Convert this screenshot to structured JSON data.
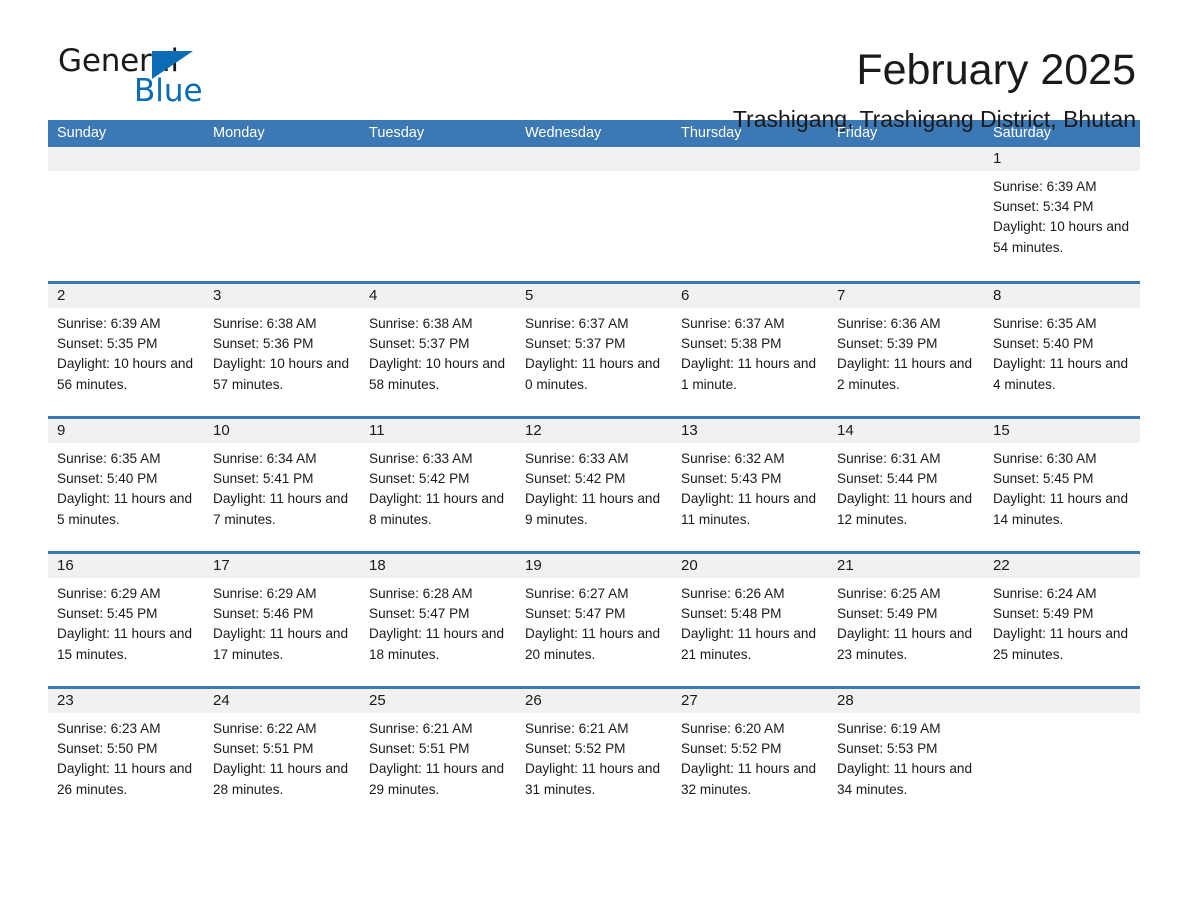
{
  "brand": {
    "name_part1": "General",
    "name_part2": "Blue",
    "triangle_color": "#0a6cb5",
    "text_color": "#1a1a1a"
  },
  "header": {
    "title": "February 2025",
    "subtitle": "Trashigang, Trashigang District, Bhutan"
  },
  "theme": {
    "header_blue": "#3b78b4",
    "date_band_gray": "#f1f1f1",
    "cell_white": "#ffffff"
  },
  "weekdays": [
    "Sunday",
    "Monday",
    "Tuesday",
    "Wednesday",
    "Thursday",
    "Friday",
    "Saturday"
  ],
  "calendar": {
    "month": "February",
    "year": "2025",
    "weeks": [
      [
        {
          "day": ""
        },
        {
          "day": ""
        },
        {
          "day": ""
        },
        {
          "day": ""
        },
        {
          "day": ""
        },
        {
          "day": ""
        },
        {
          "day": "1",
          "sunrise": "Sunrise: 6:39 AM",
          "sunset": "Sunset: 5:34 PM",
          "daylight": "Daylight: 10 hours and 54 minutes."
        }
      ],
      [
        {
          "day": "2",
          "sunrise": "Sunrise: 6:39 AM",
          "sunset": "Sunset: 5:35 PM",
          "daylight": "Daylight: 10 hours and 56 minutes."
        },
        {
          "day": "3",
          "sunrise": "Sunrise: 6:38 AM",
          "sunset": "Sunset: 5:36 PM",
          "daylight": "Daylight: 10 hours and 57 minutes."
        },
        {
          "day": "4",
          "sunrise": "Sunrise: 6:38 AM",
          "sunset": "Sunset: 5:37 PM",
          "daylight": "Daylight: 10 hours and 58 minutes."
        },
        {
          "day": "5",
          "sunrise": "Sunrise: 6:37 AM",
          "sunset": "Sunset: 5:37 PM",
          "daylight": "Daylight: 11 hours and 0 minutes."
        },
        {
          "day": "6",
          "sunrise": "Sunrise: 6:37 AM",
          "sunset": "Sunset: 5:38 PM",
          "daylight": "Daylight: 11 hours and 1 minute."
        },
        {
          "day": "7",
          "sunrise": "Sunrise: 6:36 AM",
          "sunset": "Sunset: 5:39 PM",
          "daylight": "Daylight: 11 hours and 2 minutes."
        },
        {
          "day": "8",
          "sunrise": "Sunrise: 6:35 AM",
          "sunset": "Sunset: 5:40 PM",
          "daylight": "Daylight: 11 hours and 4 minutes."
        }
      ],
      [
        {
          "day": "9",
          "sunrise": "Sunrise: 6:35 AM",
          "sunset": "Sunset: 5:40 PM",
          "daylight": "Daylight: 11 hours and 5 minutes."
        },
        {
          "day": "10",
          "sunrise": "Sunrise: 6:34 AM",
          "sunset": "Sunset: 5:41 PM",
          "daylight": "Daylight: 11 hours and 7 minutes."
        },
        {
          "day": "11",
          "sunrise": "Sunrise: 6:33 AM",
          "sunset": "Sunset: 5:42 PM",
          "daylight": "Daylight: 11 hours and 8 minutes."
        },
        {
          "day": "12",
          "sunrise": "Sunrise: 6:33 AM",
          "sunset": "Sunset: 5:42 PM",
          "daylight": "Daylight: 11 hours and 9 minutes."
        },
        {
          "day": "13",
          "sunrise": "Sunrise: 6:32 AM",
          "sunset": "Sunset: 5:43 PM",
          "daylight": "Daylight: 11 hours and 11 minutes."
        },
        {
          "day": "14",
          "sunrise": "Sunrise: 6:31 AM",
          "sunset": "Sunset: 5:44 PM",
          "daylight": "Daylight: 11 hours and 12 minutes."
        },
        {
          "day": "15",
          "sunrise": "Sunrise: 6:30 AM",
          "sunset": "Sunset: 5:45 PM",
          "daylight": "Daylight: 11 hours and 14 minutes."
        }
      ],
      [
        {
          "day": "16",
          "sunrise": "Sunrise: 6:29 AM",
          "sunset": "Sunset: 5:45 PM",
          "daylight": "Daylight: 11 hours and 15 minutes."
        },
        {
          "day": "17",
          "sunrise": "Sunrise: 6:29 AM",
          "sunset": "Sunset: 5:46 PM",
          "daylight": "Daylight: 11 hours and 17 minutes."
        },
        {
          "day": "18",
          "sunrise": "Sunrise: 6:28 AM",
          "sunset": "Sunset: 5:47 PM",
          "daylight": "Daylight: 11 hours and 18 minutes."
        },
        {
          "day": "19",
          "sunrise": "Sunrise: 6:27 AM",
          "sunset": "Sunset: 5:47 PM",
          "daylight": "Daylight: 11 hours and 20 minutes."
        },
        {
          "day": "20",
          "sunrise": "Sunrise: 6:26 AM",
          "sunset": "Sunset: 5:48 PM",
          "daylight": "Daylight: 11 hours and 21 minutes."
        },
        {
          "day": "21",
          "sunrise": "Sunrise: 6:25 AM",
          "sunset": "Sunset: 5:49 PM",
          "daylight": "Daylight: 11 hours and 23 minutes."
        },
        {
          "day": "22",
          "sunrise": "Sunrise: 6:24 AM",
          "sunset": "Sunset: 5:49 PM",
          "daylight": "Daylight: 11 hours and 25 minutes."
        }
      ],
      [
        {
          "day": "23",
          "sunrise": "Sunrise: 6:23 AM",
          "sunset": "Sunset: 5:50 PM",
          "daylight": "Daylight: 11 hours and 26 minutes."
        },
        {
          "day": "24",
          "sunrise": "Sunrise: 6:22 AM",
          "sunset": "Sunset: 5:51 PM",
          "daylight": "Daylight: 11 hours and 28 minutes."
        },
        {
          "day": "25",
          "sunrise": "Sunrise: 6:21 AM",
          "sunset": "Sunset: 5:51 PM",
          "daylight": "Daylight: 11 hours and 29 minutes."
        },
        {
          "day": "26",
          "sunrise": "Sunrise: 6:21 AM",
          "sunset": "Sunset: 5:52 PM",
          "daylight": "Daylight: 11 hours and 31 minutes."
        },
        {
          "day": "27",
          "sunrise": "Sunrise: 6:20 AM",
          "sunset": "Sunset: 5:52 PM",
          "daylight": "Daylight: 11 hours and 32 minutes."
        },
        {
          "day": "28",
          "sunrise": "Sunrise: 6:19 AM",
          "sunset": "Sunset: 5:53 PM",
          "daylight": "Daylight: 11 hours and 34 minutes."
        },
        {
          "day": ""
        }
      ]
    ]
  }
}
